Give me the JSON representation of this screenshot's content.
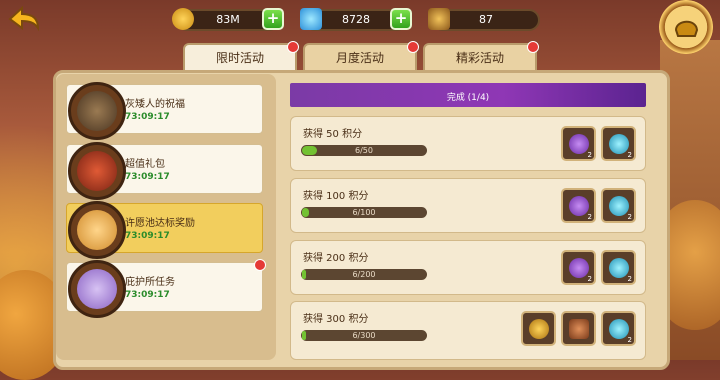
{
  "resources": {
    "gold": "83M",
    "diamonds": "8728",
    "chests": "87"
  },
  "tabs": [
    {
      "label": "限时活动"
    },
    {
      "label": "月度活动"
    },
    {
      "label": "精彩活动"
    }
  ],
  "sidebar": {
    "items": [
      {
        "label": "灰矮人的祝福",
        "timer": "73:09:17"
      },
      {
        "label": "超值礼包",
        "timer": "73:09:17"
      },
      {
        "label": "许愿池达标奖励",
        "timer": "73:09:17"
      },
      {
        "label": "庇护所任务",
        "timer": "73:09:17"
      }
    ]
  },
  "banner": {
    "status": "完成 (1/4)"
  },
  "tasks": [
    {
      "title": "获得 50 积分",
      "progress_text": "6/50",
      "progress": 0.12,
      "rewards": [
        {
          "icon": "purple-gem-icon",
          "count": "2"
        },
        {
          "icon": "blue-crystal-icon",
          "count": "2"
        }
      ]
    },
    {
      "title": "获得 100 积分",
      "progress_text": "6/100",
      "progress": 0.06,
      "rewards": [
        {
          "icon": "purple-gem-icon",
          "count": "2"
        },
        {
          "icon": "blue-crystal-icon",
          "count": "2"
        }
      ]
    },
    {
      "title": "获得 200 积分",
      "progress_text": "6/200",
      "progress": 0.03,
      "rewards": [
        {
          "icon": "purple-gem-icon",
          "count": "2"
        },
        {
          "icon": "blue-crystal-icon",
          "count": "2"
        }
      ]
    },
    {
      "title": "获得 300 积分",
      "progress_text": "6/300",
      "progress": 0.02,
      "rewards": [
        {
          "icon": "gold-helmet-icon",
          "count": ""
        },
        {
          "icon": "hero-card-icon",
          "count": ""
        },
        {
          "icon": "blue-crystal-icon",
          "count": "2"
        }
      ]
    }
  ],
  "colors": {
    "accent_green": "#73c232",
    "timer_green": "#2b8c2b",
    "notice_red": "#e53936",
    "banner_purple": "#8f37b5",
    "panel_tan": "#e8d3a9"
  }
}
